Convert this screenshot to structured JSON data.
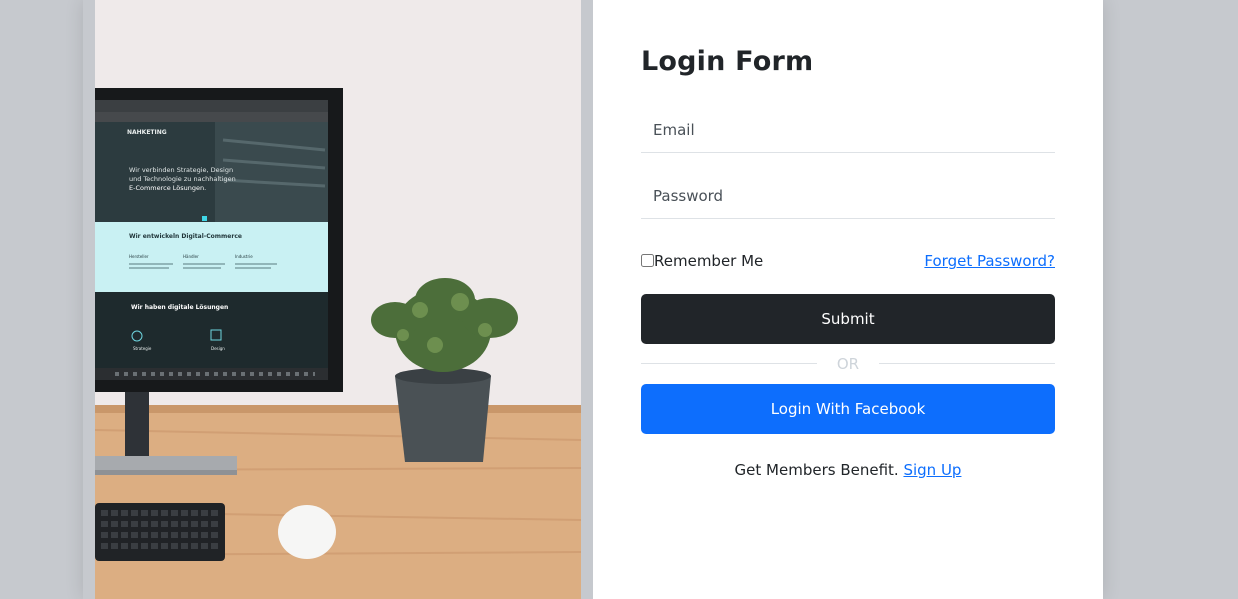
{
  "form": {
    "title": "Login Form",
    "email_placeholder": "Email",
    "password_placeholder": "Password",
    "remember_label": "Remember Me",
    "forgot_link": "Forget Password?",
    "submit_label": "Submit",
    "or_text": "OR",
    "facebook_label": "Login With Facebook",
    "signup_prefix": "Get Members Benefit.",
    "signup_link": "Sign Up"
  },
  "screen": {
    "logo": "NAHKETING",
    "headline_1": "Wir verbinden Strategie, Design",
    "headline_2": "und Technologie zu nachhaltigen",
    "headline_3": "E-Commerce Lösungen.",
    "section_1": "Wir entwickeln Digital-Commerce",
    "col_1": "Hersteller",
    "col_2": "Händler",
    "col_3": "Industrie",
    "section_2": "Wir haben digitale Lösungen",
    "item_1": "Strategie",
    "item_2": "Design"
  },
  "colors": {
    "primary": "#0d6efd",
    "dark": "#212529",
    "background": "#c6c9ce"
  }
}
